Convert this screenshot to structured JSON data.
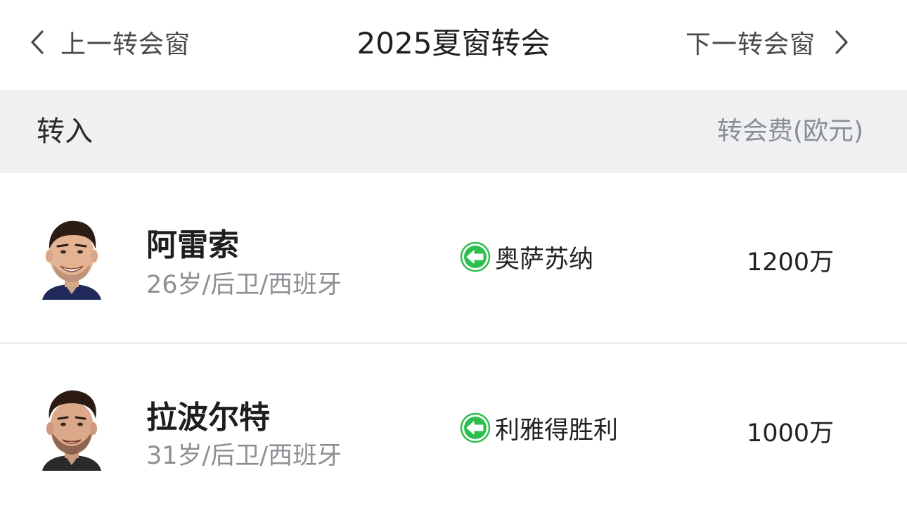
{
  "nav": {
    "prev_label": "上一转会窗",
    "next_label": "下一转会窗",
    "title": "2025夏窗转会",
    "prev_icon": "chevron-left-icon",
    "next_icon": "chevron-right-icon"
  },
  "section": {
    "title": "转入",
    "fee_header": "转会费(欧元)"
  },
  "players": [
    {
      "name": "阿雷索",
      "meta": "26岁/后卫/西班牙",
      "club": "奥萨苏纳",
      "fee": "1200万",
      "direction_icon": "arrow-left-in-icon"
    },
    {
      "name": "拉波尔特",
      "meta": "31岁/后卫/西班牙",
      "club": "利雅得胜利",
      "fee": "1000万",
      "direction_icon": "arrow-left-in-icon"
    }
  ],
  "colors": {
    "accent_green": "#2dbf4e",
    "header_bg": "#eef0f2",
    "muted_text": "#8c8f93"
  }
}
